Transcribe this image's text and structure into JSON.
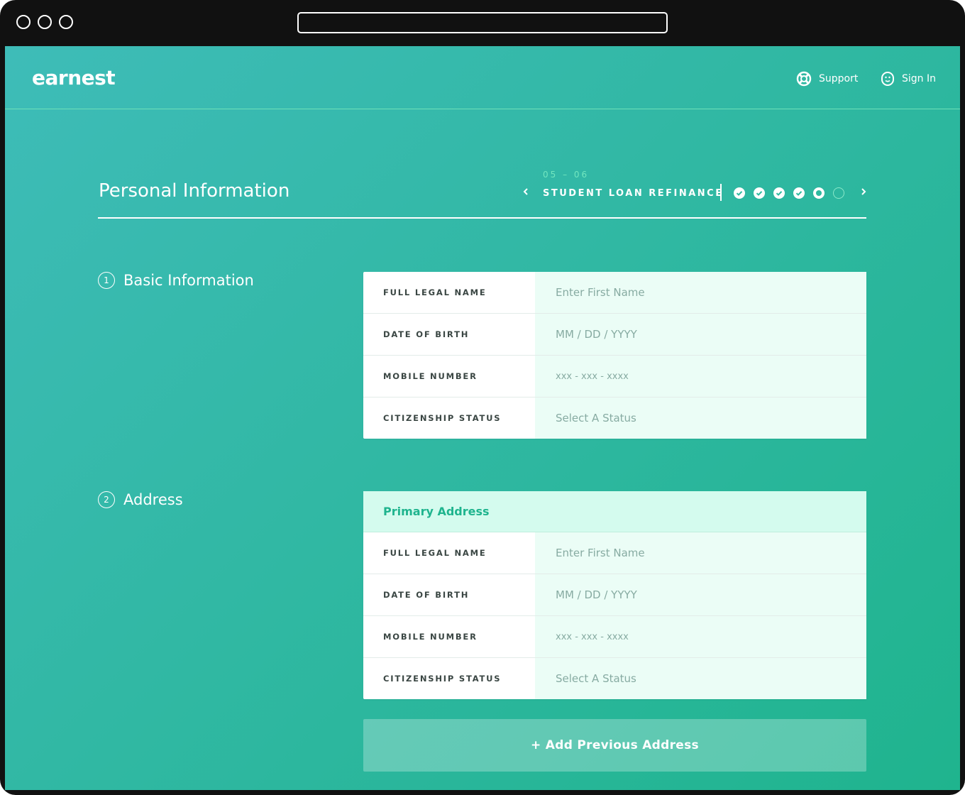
{
  "brand": {
    "logo": "earnest",
    "accent": "#1fb48e",
    "input_bg": "#ebfdf6",
    "header_line": "#6ee0b8"
  },
  "nav": {
    "support": {
      "label": "Support",
      "icon": "lifebuoy-icon"
    },
    "signin": {
      "label": "Sign In",
      "icon": "face-icon"
    }
  },
  "page": {
    "title": "Personal Information",
    "step_number": "05 – 06",
    "step_name": "STUDENT LOAN REFINANCE",
    "steps": [
      "done",
      "done",
      "done",
      "done",
      "current",
      "todo"
    ]
  },
  "sections": {
    "basic": {
      "num": "1",
      "title": "Basic Information",
      "rows": [
        {
          "label": "FULL LEGAL NAME",
          "placeholder": "Enter First Name"
        },
        {
          "label": "DATE OF BIRTH",
          "placeholder": "MM / DD / YYYY"
        },
        {
          "label": "MOBILE NUMBER",
          "placeholder": "xxx - xxx - xxxx"
        },
        {
          "label": "CITIZENSHIP STATUS",
          "placeholder": "Select A Status"
        }
      ]
    },
    "address": {
      "num": "2",
      "title": "Address",
      "card_title": "Primary Address",
      "rows": [
        {
          "label": "FULL LEGAL NAME",
          "placeholder": "Enter First Name"
        },
        {
          "label": "DATE OF BIRTH",
          "placeholder": "MM / DD / YYYY"
        },
        {
          "label": "MOBILE NUMBER",
          "placeholder": "xxx - xxx - xxxx"
        },
        {
          "label": "CITIZENSHIP STATUS",
          "placeholder": "Select A Status"
        }
      ],
      "add_button": "+ Add Previous Address"
    }
  }
}
